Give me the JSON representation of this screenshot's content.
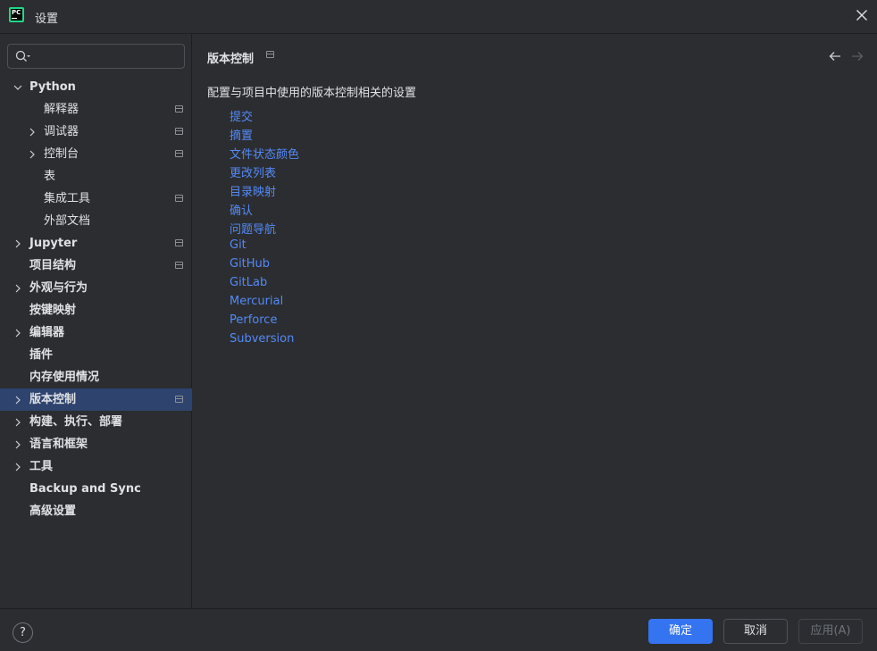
{
  "window": {
    "title": "设置"
  },
  "sidebar": {
    "search_placeholder": "",
    "items": [
      {
        "label": "Python",
        "level": 0,
        "expanded": true,
        "project": false
      },
      {
        "label": "解释器",
        "level": 1,
        "project": true
      },
      {
        "label": "调试器",
        "level": 1,
        "collapsed": true,
        "project": true
      },
      {
        "label": "控制台",
        "level": 1,
        "collapsed": true,
        "project": true
      },
      {
        "label": "表",
        "level": 1,
        "project": false
      },
      {
        "label": "集成工具",
        "level": 1,
        "project": true
      },
      {
        "label": "外部文档",
        "level": 1,
        "project": false
      },
      {
        "label": "Jupyter",
        "level": 0,
        "collapsed": true,
        "project": true
      },
      {
        "label": "项目结构",
        "level": 0,
        "project": true
      },
      {
        "label": "外观与行为",
        "level": 0,
        "collapsed": true,
        "project": false
      },
      {
        "label": "按键映射",
        "level": 0,
        "project": false
      },
      {
        "label": "编辑器",
        "level": 0,
        "collapsed": true,
        "project": false
      },
      {
        "label": "插件",
        "level": 0,
        "project": false
      },
      {
        "label": "内存使用情况",
        "level": 0,
        "project": false
      },
      {
        "label": "版本控制",
        "level": 0,
        "collapsed": true,
        "project": true,
        "selected": true
      },
      {
        "label": "构建、执行、部署",
        "level": 0,
        "collapsed": true,
        "project": false
      },
      {
        "label": "语言和框架",
        "level": 0,
        "collapsed": true,
        "project": false
      },
      {
        "label": "工具",
        "level": 0,
        "collapsed": true,
        "project": false
      },
      {
        "label": "Backup and Sync",
        "level": 0,
        "project": false
      },
      {
        "label": "高级设置",
        "level": 0,
        "project": false
      }
    ]
  },
  "main": {
    "breadcrumb": "版本控制",
    "description": "配置与项目中使用的版本控制相关的设置",
    "links": [
      "提交",
      "摘置",
      "文件状态颜色",
      "更改列表",
      "目录映射",
      "确认",
      "问题导航",
      "Git",
      "GitHub",
      "GitLab",
      "Mercurial",
      "Perforce",
      "Subversion"
    ]
  },
  "footer": {
    "help_label": "?",
    "ok_label": "确定",
    "cancel_label": "取消",
    "apply_label": "应用(A)"
  },
  "colors": {
    "background": "#2b2d30",
    "selection": "#2e436e",
    "link": "#548af7",
    "primary_button": "#3574f0",
    "text": "#dfe1e5"
  }
}
